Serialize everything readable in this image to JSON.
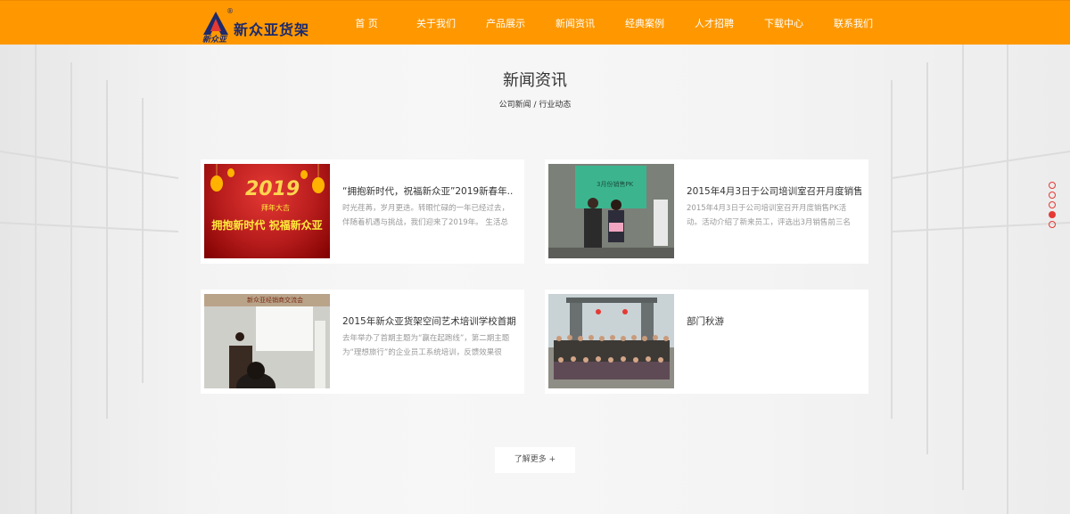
{
  "header": {
    "logo_text": "新众亚货架",
    "logo_script": "新众亚",
    "logo_reg": "®",
    "nav": [
      "首 页",
      "关于我们",
      "产品展示",
      "新闻资讯",
      "经典案例",
      "人才招聘",
      "下载中心",
      "联系我们"
    ]
  },
  "section": {
    "title": "新闻资讯",
    "subnav": [
      "公司新闻",
      " / ",
      "行业动态"
    ]
  },
  "news": [
    {
      "title": "“拥抱新时代，祝福新众亚”2019新春年..",
      "summary": "时光荏苒，岁月更迭。转眼忙碌的一年已经过去，伴随着机遇与挑战，我们迎来了2019年。 生活总需",
      "image_text_top": "2019",
      "image_text_sub": "拜年大吉",
      "image_text_main": "拥抱新时代  祝福新众亚"
    },
    {
      "title": "2015年4月3日于公司培训室召开月度销售.",
      "summary": "2015年4月3日于公司培训室召开月度销售PK活动。活动介绍了新来员工，评选出3月销售前三名和团队",
      "image_text_top": "3月份销售PK"
    },
    {
      "title": "2015年新众亚货架空间艺术培训学校首期..",
      "summary": "去年举办了首期主题为“赢在起跑线”，第二期主题为“理想旅行”的企业员工系统培训，反馈效果很",
      "image_text_top": "新众亚经销商交流会"
    },
    {
      "title": "部门秋游",
      "summary": ""
    }
  ],
  "more_label": "了解更多 +",
  "colors": {
    "header": "#ff9800",
    "logo": "#1d2a6b",
    "dot": "#e53935"
  },
  "pager": {
    "count": 5,
    "active_index": 3
  }
}
